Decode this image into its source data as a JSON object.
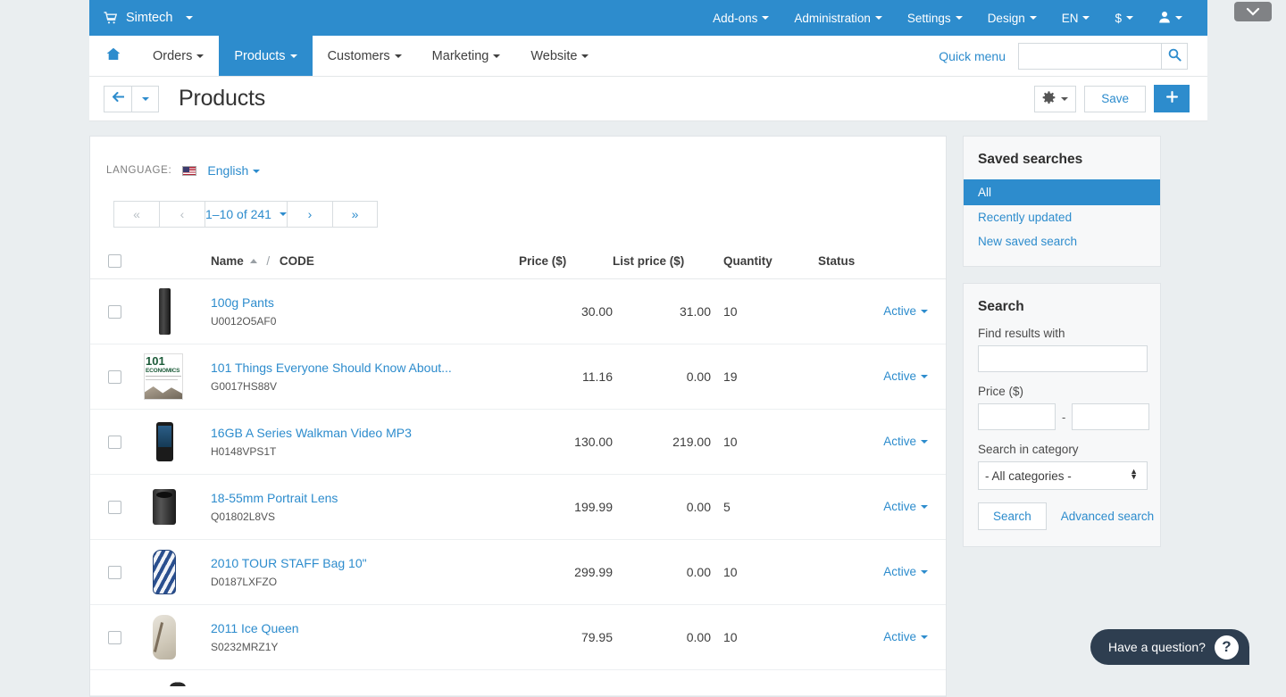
{
  "window": {
    "collapse_icon": "chevron-down-icon"
  },
  "topbar": {
    "brand": "Simtech",
    "cart_icon": "shopping-cart-icon",
    "menus": [
      "Add-ons",
      "Administration",
      "Settings",
      "Design",
      "EN",
      "$"
    ],
    "account_icon": "user-icon"
  },
  "navbar": {
    "home_icon": "home-icon",
    "items": [
      {
        "label": "Orders",
        "active": false
      },
      {
        "label": "Products",
        "active": true
      },
      {
        "label": "Customers",
        "active": false
      },
      {
        "label": "Marketing",
        "active": false
      },
      {
        "label": "Website",
        "active": false
      }
    ],
    "quick_menu": "Quick menu",
    "search_value": "",
    "search_placeholder": "",
    "search_icon": "search-icon"
  },
  "titlebar": {
    "back_icon": "arrow-left-icon",
    "back_caret_icon": "caret-down-icon",
    "title": "Products",
    "gear_icon": "gear-icon",
    "save_label": "Save",
    "add_label": "+"
  },
  "toolbar": {
    "language_label": "LANGUAGE:",
    "language_flag": "us-flag-icon",
    "language_value": "English",
    "pagination": {
      "first": "«",
      "prev": "‹",
      "count": "1–10 of 241",
      "next": "›",
      "last": "»"
    }
  },
  "table": {
    "headers": {
      "name": "Name",
      "sort_icon": "sort-asc-icon",
      "separator": "/",
      "code": "CODE",
      "price": "Price ($)",
      "list_price": "List price ($)",
      "quantity": "Quantity",
      "status": "Status"
    },
    "rows": [
      {
        "thumb": "th-pants",
        "thumb_name": "product-thumbnail-pants",
        "name": "100g Pants",
        "code": "U0012O5AF0",
        "price": "30.00",
        "list_price": "31.00",
        "quantity": "10",
        "status": "Active"
      },
      {
        "thumb": "th-book",
        "thumb_name": "product-thumbnail-book",
        "name": "101 Things Everyone Should Know About...",
        "code": "G0017HS88V",
        "price": "11.16",
        "list_price": "0.00",
        "quantity": "19",
        "status": "Active"
      },
      {
        "thumb": "th-phone",
        "thumb_name": "product-thumbnail-walkman",
        "name": "16GB A Series Walkman Video MP3",
        "code": "H0148VPS1T",
        "price": "130.00",
        "list_price": "219.00",
        "quantity": "10",
        "status": "Active"
      },
      {
        "thumb": "th-lens",
        "thumb_name": "product-thumbnail-lens",
        "name": "18-55mm Portrait Lens",
        "code": "Q01802L8VS",
        "price": "199.99",
        "list_price": "0.00",
        "quantity": "5",
        "status": "Active"
      },
      {
        "thumb": "th-bag",
        "thumb_name": "product-thumbnail-golf-bag",
        "name": "2010 TOUR STAFF Bag 10\"",
        "code": "D0187LXFZO",
        "price": "299.99",
        "list_price": "0.00",
        "quantity": "10",
        "status": "Active"
      },
      {
        "thumb": "th-ice",
        "thumb_name": "product-thumbnail-ice-queen",
        "name": "2011 Ice Queen",
        "code": "S0232MRZ1Y",
        "price": "79.95",
        "list_price": "0.00",
        "quantity": "10",
        "status": "Active"
      }
    ]
  },
  "sidebar": {
    "saved_searches": {
      "title": "Saved searches",
      "items": [
        {
          "label": "All",
          "selected": true
        },
        {
          "label": "Recently updated",
          "selected": false
        },
        {
          "label": "New saved search",
          "selected": false
        }
      ]
    },
    "search": {
      "title": "Search",
      "find_label": "Find results with",
      "find_value": "",
      "price_label": "Price ($)",
      "price_from": "",
      "price_to": "",
      "price_dash": "-",
      "category_label": "Search in category",
      "category_value": "- All categories -",
      "search_button": "Search",
      "advanced_link": "Advanced search"
    }
  },
  "help_widget": {
    "text": "Have a question?",
    "badge": "?"
  },
  "colors": {
    "accent": "#2d8ccd",
    "page_bg": "#eaeef0",
    "panel_bg": "#f7f8f9",
    "help_bg": "#2e3e50"
  }
}
